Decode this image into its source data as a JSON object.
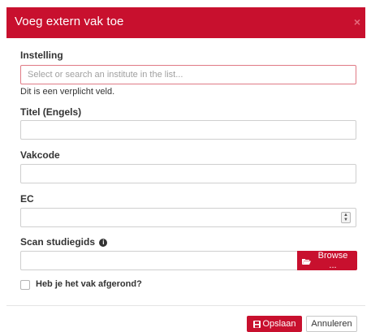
{
  "dialog": {
    "title": "Voeg extern vak toe",
    "close_glyph": "×"
  },
  "form": {
    "institution": {
      "label": "Instelling",
      "placeholder": "Select or search an institute in the list...",
      "error": "Dit is een verplicht veld."
    },
    "title_en": {
      "label": "Titel (Engels)",
      "value": ""
    },
    "course_code": {
      "label": "Vakcode",
      "value": ""
    },
    "ec": {
      "label": "EC",
      "value": ""
    },
    "scan": {
      "label": "Scan studiegids",
      "info_glyph": "i",
      "browse_label": "Browse ..."
    },
    "completed": {
      "label": "Heb je het vak afgerond?",
      "checked": false
    }
  },
  "footer": {
    "save_label": "Opslaan",
    "cancel_label": "Annuleren"
  },
  "colors": {
    "brand": "#c8102e",
    "error_border": "#e07a85"
  },
  "icons": {
    "close": "close-icon",
    "info": "info-icon",
    "browse": "folder-open-icon",
    "save": "save-icon"
  }
}
